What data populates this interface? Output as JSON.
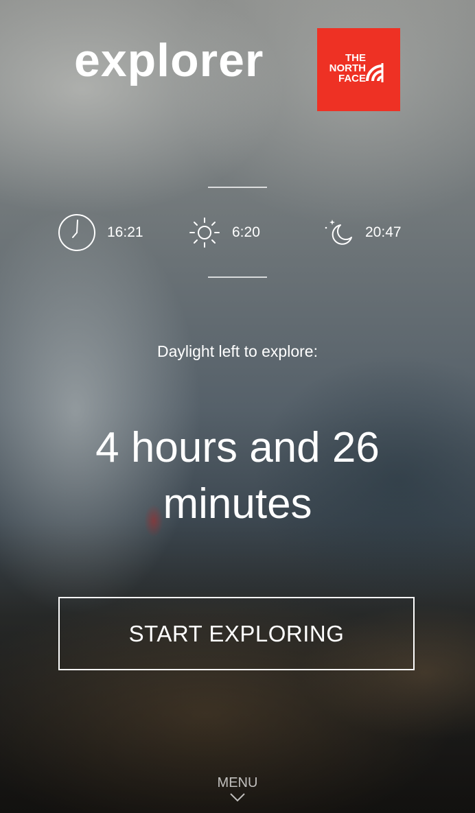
{
  "brand": {
    "title": "explorer",
    "logo_lines": [
      "THE",
      "NORTH",
      "FACE"
    ],
    "logo_color": "#ee3124"
  },
  "stats": [
    {
      "icon": "clock-icon",
      "value": "16:21"
    },
    {
      "icon": "sun-icon",
      "value": "6:20"
    },
    {
      "icon": "moon-icon",
      "value": "20:47"
    }
  ],
  "daylight": {
    "label": "Daylight left to explore:",
    "remaining": "4 hours and 26 minutes"
  },
  "cta": {
    "label": "START EXPLORING"
  },
  "menu": {
    "label": "MENU",
    "icon": "chevron-down-icon"
  }
}
